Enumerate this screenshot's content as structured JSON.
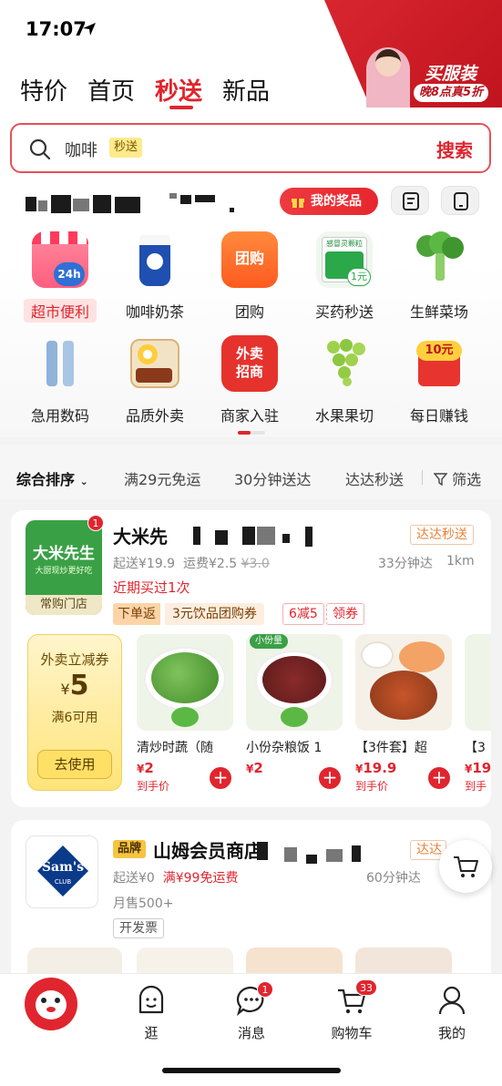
{
  "status_bar": {
    "time": "17:07"
  },
  "promo": {
    "title": "买服装",
    "subtitle": "晚8点真5折"
  },
  "tabs": [
    {
      "label": "特价"
    },
    {
      "label": "首页"
    },
    {
      "label": "秒送"
    },
    {
      "label": "新品"
    }
  ],
  "search": {
    "query": "咖啡",
    "chip": "秒送",
    "button": "搜索"
  },
  "header_actions": {
    "prize": "我的奖品"
  },
  "categories": [
    {
      "label": "超市便利",
      "icon": "supermarket-icon",
      "badge": "24h"
    },
    {
      "label": "咖啡奶茶",
      "icon": "coffee-cup-icon"
    },
    {
      "label": "团购",
      "icon": "group-buy-icon",
      "icon_text": "团购"
    },
    {
      "label": "买药秒送",
      "icon": "medicine-icon",
      "icon_text": "1元",
      "icon_top": "感冒灵颗粒"
    },
    {
      "label": "生鲜菜场",
      "icon": "broccoli-icon"
    },
    {
      "label": "急用数码",
      "icon": "cable-icon"
    },
    {
      "label": "品质外卖",
      "icon": "meal-icon"
    },
    {
      "label": "商家入驻",
      "icon": "merchant-icon",
      "icon_text": "外卖招商"
    },
    {
      "label": "水果果切",
      "icon": "grapes-icon"
    },
    {
      "label": "每日赚钱",
      "icon": "money-icon",
      "icon_text": "10元"
    }
  ],
  "filters": [
    "综合排序",
    "满29元免运",
    "30分钟送达",
    "达达秒送",
    "筛选"
  ],
  "store1": {
    "logo_main": "大米先生",
    "logo_sub": "大厨现炒更好吃",
    "logo_tag": "常购门店",
    "badge": "1",
    "name": "大米先",
    "delivery_tag": "达达秒送",
    "min_order": "起送¥19.9",
    "fee": "运费¥2.5",
    "fee_old": "¥3.0",
    "time": "33分钟达",
    "distance": "1km",
    "recent": "近期买过1次",
    "coupon_left": "下单返",
    "coupon_right": "3元饮品团购券",
    "promo_deal": "6减5",
    "promo_claim": "领券",
    "voucher": {
      "title": "外卖立减券",
      "amount": "5",
      "currency": "¥",
      "condition": "满6可用",
      "button": "去使用"
    },
    "products": [
      {
        "name": "清炒时蔬（随",
        "price": "2",
        "currency": "¥",
        "sub": "到手价"
      },
      {
        "name": "小份杂粮饭 1",
        "price": "2",
        "currency": "¥",
        "sub": "",
        "tag": "小份量"
      },
      {
        "name": "【3件套】超",
        "price": "19.9",
        "currency": "¥",
        "sub": "到手价"
      },
      {
        "name": "【3",
        "price": "19",
        "currency": "¥",
        "sub": "到手"
      }
    ]
  },
  "store2": {
    "brand_tag": "品牌",
    "name": "山姆会员商店",
    "logo_text": "Sam's",
    "logo_club": "CLUB",
    "delivery_tag": "达达",
    "min_order": "起送¥0",
    "free_ship": "满¥99免运费",
    "time": "60分钟达",
    "monthly": "月售500+",
    "invoice": "开发票"
  },
  "bottom_nav": [
    {
      "label": "",
      "icon": "mascot-dog-icon"
    },
    {
      "label": "逛",
      "icon": "face-icon"
    },
    {
      "label": "消息",
      "icon": "chat-bubble-icon",
      "badge": "1"
    },
    {
      "label": "购物车",
      "icon": "cart-icon",
      "badge": "33"
    },
    {
      "label": "我的",
      "icon": "person-icon"
    }
  ]
}
